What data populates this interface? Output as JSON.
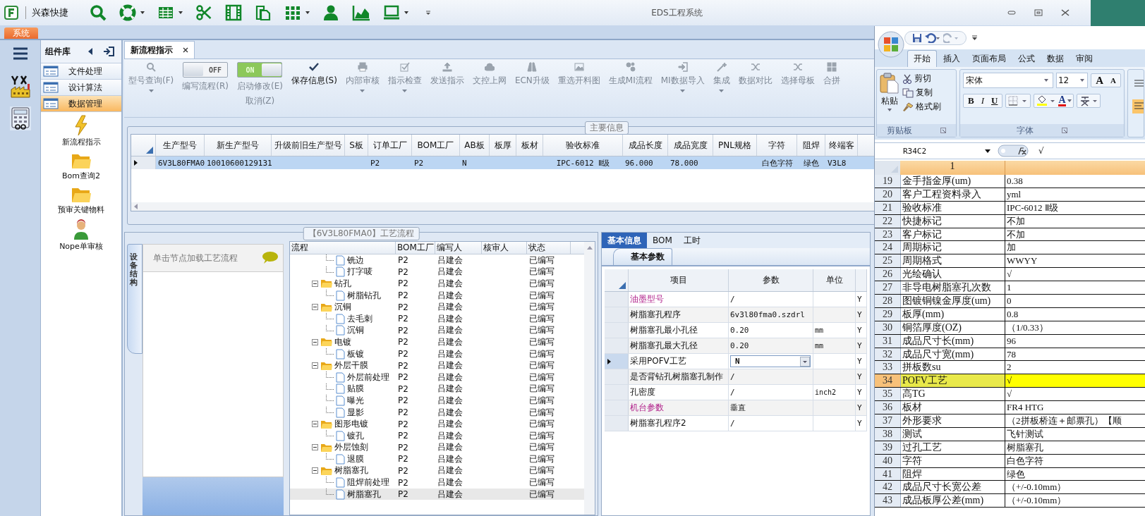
{
  "window": {
    "title": "EDS工程系统"
  },
  "quick_bar": {
    "brand": "兴森快捷",
    "tools": [
      {
        "kind": "search",
        "dropdown": false
      },
      {
        "kind": "lifebuoy",
        "dropdown": true
      },
      {
        "kind": "table",
        "dropdown": true
      },
      {
        "kind": "scissors",
        "dropdown": false
      },
      {
        "kind": "film",
        "dropdown": false
      },
      {
        "kind": "copy",
        "dropdown": false
      },
      {
        "kind": "grid",
        "dropdown": true
      },
      {
        "kind": "person",
        "dropdown": false
      },
      {
        "kind": "chart",
        "dropdown": false
      },
      {
        "kind": "monitor",
        "dropdown": true
      }
    ]
  },
  "app_tabs": [
    {
      "label": "系统",
      "selected": true
    }
  ],
  "component_panel": {
    "title": "组件库",
    "categories": [
      {
        "label": "文件处理",
        "selected": false
      },
      {
        "label": "设计算法",
        "selected": false
      },
      {
        "label": "数据管理",
        "selected": true
      }
    ],
    "items": [
      {
        "label": "新流程指示",
        "kind": "lightning"
      },
      {
        "label": "Bom查询2",
        "kind": "folder"
      },
      {
        "label": "预审关键物料",
        "kind": "folder"
      },
      {
        "label": "Nope单审核",
        "kind": "person"
      }
    ]
  },
  "doc_tabs": [
    {
      "label": "新流程指示",
      "selected": true
    }
  ],
  "toolbar": [
    {
      "kind": "button",
      "label": "型号查询(F)",
      "dropdown": true,
      "disabled": true
    },
    {
      "kind": "toggle",
      "label": "编写流程(R)",
      "switch_text": "OFF",
      "on": false,
      "disabled": true
    },
    {
      "kind": "toggle",
      "label": "启动修改(E)",
      "label2": "取消(Z)",
      "switch_text": "ON",
      "on": true,
      "disabled": true
    },
    {
      "kind": "button",
      "label": "保存信息(S)",
      "dropdown": false,
      "disabled": false
    },
    {
      "kind": "button",
      "label": "内部审核",
      "dropdown": true,
      "disabled": true
    },
    {
      "kind": "button",
      "label": "指示检查",
      "dropdown": true,
      "disabled": true
    },
    {
      "kind": "button",
      "label": "发送指示",
      "dropdown": false,
      "disabled": true
    },
    {
      "kind": "button",
      "label": "文控上网",
      "dropdown": false,
      "disabled": true
    },
    {
      "kind": "button",
      "label": "ECN升级",
      "dropdown": false,
      "disabled": true
    },
    {
      "kind": "button",
      "label": "重选开料图",
      "dropdown": false,
      "disabled": true
    },
    {
      "kind": "button",
      "label": "生成MI流程",
      "dropdown": false,
      "disabled": true
    },
    {
      "kind": "button",
      "label": "MI数据导入",
      "dropdown": true,
      "disabled": true
    },
    {
      "kind": "button",
      "label": "集成",
      "dropdown": true,
      "disabled": true
    },
    {
      "kind": "button",
      "label": "数据对比",
      "dropdown": false,
      "disabled": true
    },
    {
      "kind": "button",
      "label": "选择母板",
      "dropdown": false,
      "disabled": true
    },
    {
      "kind": "button",
      "label": "合拼",
      "dropdown": false,
      "disabled": true
    }
  ],
  "main_info": {
    "title": "主要信息",
    "columns": [
      "生产型号",
      "新生产型号",
      "升级前旧生产型号",
      "S板",
      "订单工厂",
      "BOM工厂",
      "AB板",
      "板厚",
      "板材",
      "验收标准",
      "成品长度",
      "成品宽度",
      "PNL规格",
      "字符",
      "阻焊",
      "终端客"
    ],
    "rows": [
      {
        "selected": true,
        "cells": [
          "6V3L80FMA0",
          "10010600129131",
          null,
          null,
          "P2",
          "P2",
          "N",
          null,
          null,
          "IPC-6012 Ⅱ级",
          "96.000",
          "78.000",
          null,
          "白色字符",
          "绿色",
          "V3L8"
        ]
      }
    ]
  },
  "process": {
    "title": "【6V3L80FMA0】工艺流程",
    "side_tab": "设备结构",
    "hint": "单击节点加载工艺流程",
    "columns": [
      "流程",
      "BOM工厂",
      "编写人",
      "核审人",
      "状态"
    ],
    "rows": [
      {
        "kind": "file",
        "label": "铣边",
        "bom": "P2",
        "writer": "吕建会",
        "status": "已编写",
        "selected": false
      },
      {
        "kind": "file",
        "label": "打字唛",
        "bom": "P2",
        "writer": "吕建会",
        "status": "已编写",
        "selected": false
      },
      {
        "kind": "folder",
        "label": "钻孔",
        "bom": "P2",
        "writer": "吕建会",
        "status": "已编写",
        "selected": false,
        "expanded": true,
        "children": [
          {
            "kind": "file",
            "label": "树脂钻孔",
            "bom": "P2",
            "writer": "吕建会",
            "status": "已编写",
            "selected": false
          }
        ]
      },
      {
        "kind": "folder",
        "label": "沉铜",
        "bom": "P2",
        "writer": "吕建会",
        "status": "已编写",
        "selected": false,
        "expanded": true,
        "children": [
          {
            "kind": "file",
            "label": "去毛刺",
            "bom": "P2",
            "writer": "吕建会",
            "status": "已编写",
            "selected": false
          },
          {
            "kind": "file",
            "label": "沉铜",
            "bom": "P2",
            "writer": "吕建会",
            "status": "已编写",
            "selected": false
          }
        ]
      },
      {
        "kind": "folder",
        "label": "电镀",
        "bom": "P2",
        "writer": "吕建会",
        "status": "已编写",
        "selected": false,
        "expanded": true,
        "children": [
          {
            "kind": "file",
            "label": "板镀",
            "bom": "P2",
            "writer": "吕建会",
            "status": "已编写",
            "selected": false
          }
        ]
      },
      {
        "kind": "folder",
        "label": "外层干膜",
        "bom": "P2",
        "writer": "吕建会",
        "status": "已编写",
        "selected": false,
        "expanded": true,
        "children": [
          {
            "kind": "file",
            "label": "外层前处理",
            "bom": "P2",
            "writer": "吕建会",
            "status": "已编写",
            "selected": false
          },
          {
            "kind": "file",
            "label": "贴膜",
            "bom": "P2",
            "writer": "吕建会",
            "status": "已编写",
            "selected": false
          },
          {
            "kind": "file",
            "label": "曝光",
            "bom": "P2",
            "writer": "吕建会",
            "status": "已编写",
            "selected": false
          },
          {
            "kind": "file",
            "label": "显影",
            "bom": "P2",
            "writer": "吕建会",
            "status": "已编写",
            "selected": false
          }
        ]
      },
      {
        "kind": "folder",
        "label": "图形电镀",
        "bom": "P2",
        "writer": "吕建会",
        "status": "已编写",
        "selected": false,
        "expanded": true,
        "children": [
          {
            "kind": "file",
            "label": "镀孔",
            "bom": "P2",
            "writer": "吕建会",
            "status": "已编写",
            "selected": false
          }
        ]
      },
      {
        "kind": "folder",
        "label": "外层蚀刻",
        "bom": "P2",
        "writer": "吕建会",
        "status": "已编写",
        "selected": false,
        "expanded": true,
        "children": [
          {
            "kind": "file",
            "label": "退膜",
            "bom": "P2",
            "writer": "吕建会",
            "status": "已编写",
            "selected": false
          }
        ]
      },
      {
        "kind": "folder",
        "label": "树脂塞孔",
        "bom": "P2",
        "writer": "吕建会",
        "status": "已编写",
        "selected": false,
        "expanded": true,
        "children": [
          {
            "kind": "file",
            "label": "阻焊前处理",
            "bom": "P2",
            "writer": "吕建会",
            "status": "已编写",
            "selected": false
          },
          {
            "kind": "file",
            "label": "树脂塞孔",
            "bom": "P2",
            "writer": "吕建会",
            "status": "已编写",
            "selected": true
          }
        ]
      }
    ]
  },
  "detail": {
    "tabs": [
      {
        "label": "基本信息",
        "selected": true
      },
      {
        "label": "BOM",
        "selected": false
      },
      {
        "label": "工时",
        "selected": false
      }
    ],
    "sub_tabs": [
      {
        "label": "基本参数",
        "selected": true
      }
    ],
    "columns": [
      "项目",
      "参数",
      "单位"
    ],
    "rows": [
      {
        "kind": "text",
        "name": "油墨型号",
        "value": "/",
        "flag": "Y",
        "highlighted": true,
        "selected": false
      },
      {
        "kind": "text",
        "name": "树脂塞孔程序",
        "value": "6v3l80fma0.szdrl",
        "flag": "Y",
        "highlighted": false,
        "selected": false
      },
      {
        "kind": "text",
        "name": "树脂塞孔最小孔径",
        "value": "0.20",
        "unit": "mm",
        "flag": "Y",
        "highlighted": false,
        "selected": false
      },
      {
        "kind": "text",
        "name": "树脂塞孔最大孔径",
        "value": "0.20",
        "unit": "mm",
        "flag": "Y",
        "highlighted": false,
        "selected": false
      },
      {
        "kind": "dropdown",
        "name": "采用POFV工艺",
        "value": "N",
        "flag": "Y",
        "highlighted": false,
        "selected": true
      },
      {
        "kind": "text",
        "name": "是否背钻孔树脂塞孔制作",
        "value": "/",
        "flag": "Y",
        "highlighted": false,
        "selected": false
      },
      {
        "kind": "text",
        "name": "孔密度",
        "value": "/",
        "unit": "inch2",
        "flag": "Y",
        "highlighted": false,
        "selected": false
      },
      {
        "kind": "text",
        "name": "机台参数",
        "value": "垂直",
        "flag": "Y",
        "highlighted": true,
        "selected": false
      },
      {
        "kind": "text",
        "name": "树脂塞孔程序2",
        "value": "/",
        "flag": "Y",
        "highlighted": false,
        "selected": false
      }
    ]
  },
  "excel": {
    "tabs": [
      {
        "label": "开始",
        "selected": true
      },
      {
        "label": "插入",
        "selected": false
      },
      {
        "label": "页面布局",
        "selected": false
      },
      {
        "label": "公式",
        "selected": false
      },
      {
        "label": "数据",
        "selected": false
      },
      {
        "label": "审阅",
        "selected": false
      }
    ],
    "clipboard": {
      "paste": "粘贴",
      "cut": "剪切",
      "copy": "复制",
      "format_painter": "格式刷",
      "group": "剪贴板"
    },
    "font": {
      "name": "宋体",
      "size": "12",
      "grow": "A",
      "shrink": "A",
      "bold": "B",
      "italic": "I",
      "underline": "U",
      "color_letter": "A",
      "group": "字体"
    },
    "name_box": "R34C2",
    "formula": "√",
    "column_header": "1",
    "rows": [
      {
        "num": "19",
        "label": "金手指金厚(um)",
        "value": "0.38",
        "selected": false
      },
      {
        "num": "20",
        "label": "客户工程资料录入",
        "value": "yml",
        "selected": false
      },
      {
        "num": "21",
        "label": "验收标准",
        "value": "IPC-6012 Ⅱ级",
        "selected": false
      },
      {
        "num": "22",
        "label": "快捷标记",
        "value": "不加",
        "selected": false
      },
      {
        "num": "23",
        "label": "客户标记",
        "value": "不加",
        "selected": false
      },
      {
        "num": "24",
        "label": "周期标记",
        "value": "加",
        "selected": false
      },
      {
        "num": "25",
        "label": "周期格式",
        "value": "WWYY",
        "selected": false
      },
      {
        "num": "26",
        "label": "光绘确认",
        "value": "√",
        "selected": false
      },
      {
        "num": "27",
        "label": "非导电树脂塞孔次数",
        "value": "1",
        "selected": false
      },
      {
        "num": "28",
        "label": "图镀铜镍金厚度(um)",
        "value": "0",
        "selected": false
      },
      {
        "num": "29",
        "label": "板厚(mm)",
        "value": "0.8",
        "selected": false
      },
      {
        "num": "30",
        "label": "铜箔厚度(OZ)",
        "value": "（1/0.33）",
        "selected": false
      },
      {
        "num": "31",
        "label": "成品尺寸长(mm)",
        "value": "96",
        "selected": false
      },
      {
        "num": "32",
        "label": "成品尺寸宽(mm)",
        "value": "78",
        "selected": false
      },
      {
        "num": "33",
        "label": "拼板数su",
        "value": "2",
        "selected": false
      },
      {
        "num": "34",
        "label": "POFV工艺",
        "value": "√",
        "selected": true
      },
      {
        "num": "35",
        "label": "高TG",
        "value": "√",
        "selected": false
      },
      {
        "num": "36",
        "label": "板材",
        "value": "FR4 HTG",
        "selected": false
      },
      {
        "num": "37",
        "label": "外形要求",
        "value": "（2拼板桥连＋邮票孔）【顺",
        "selected": false
      },
      {
        "num": "38",
        "label": "测试",
        "value": "飞针测试",
        "selected": false
      },
      {
        "num": "39",
        "label": "过孔工艺",
        "value": "树脂塞孔",
        "selected": false
      },
      {
        "num": "40",
        "label": "字符",
        "value": "白色字符",
        "selected": false
      },
      {
        "num": "41",
        "label": "阻焊",
        "value": "绿色",
        "selected": false
      },
      {
        "num": "42",
        "label": "成品尺寸长宽公差",
        "value": "（+/-0.10mm）",
        "selected": false
      },
      {
        "num": "43",
        "label": "成品板厚公差(mm)",
        "value": "（+/-0.10mm）",
        "selected": false
      }
    ]
  }
}
